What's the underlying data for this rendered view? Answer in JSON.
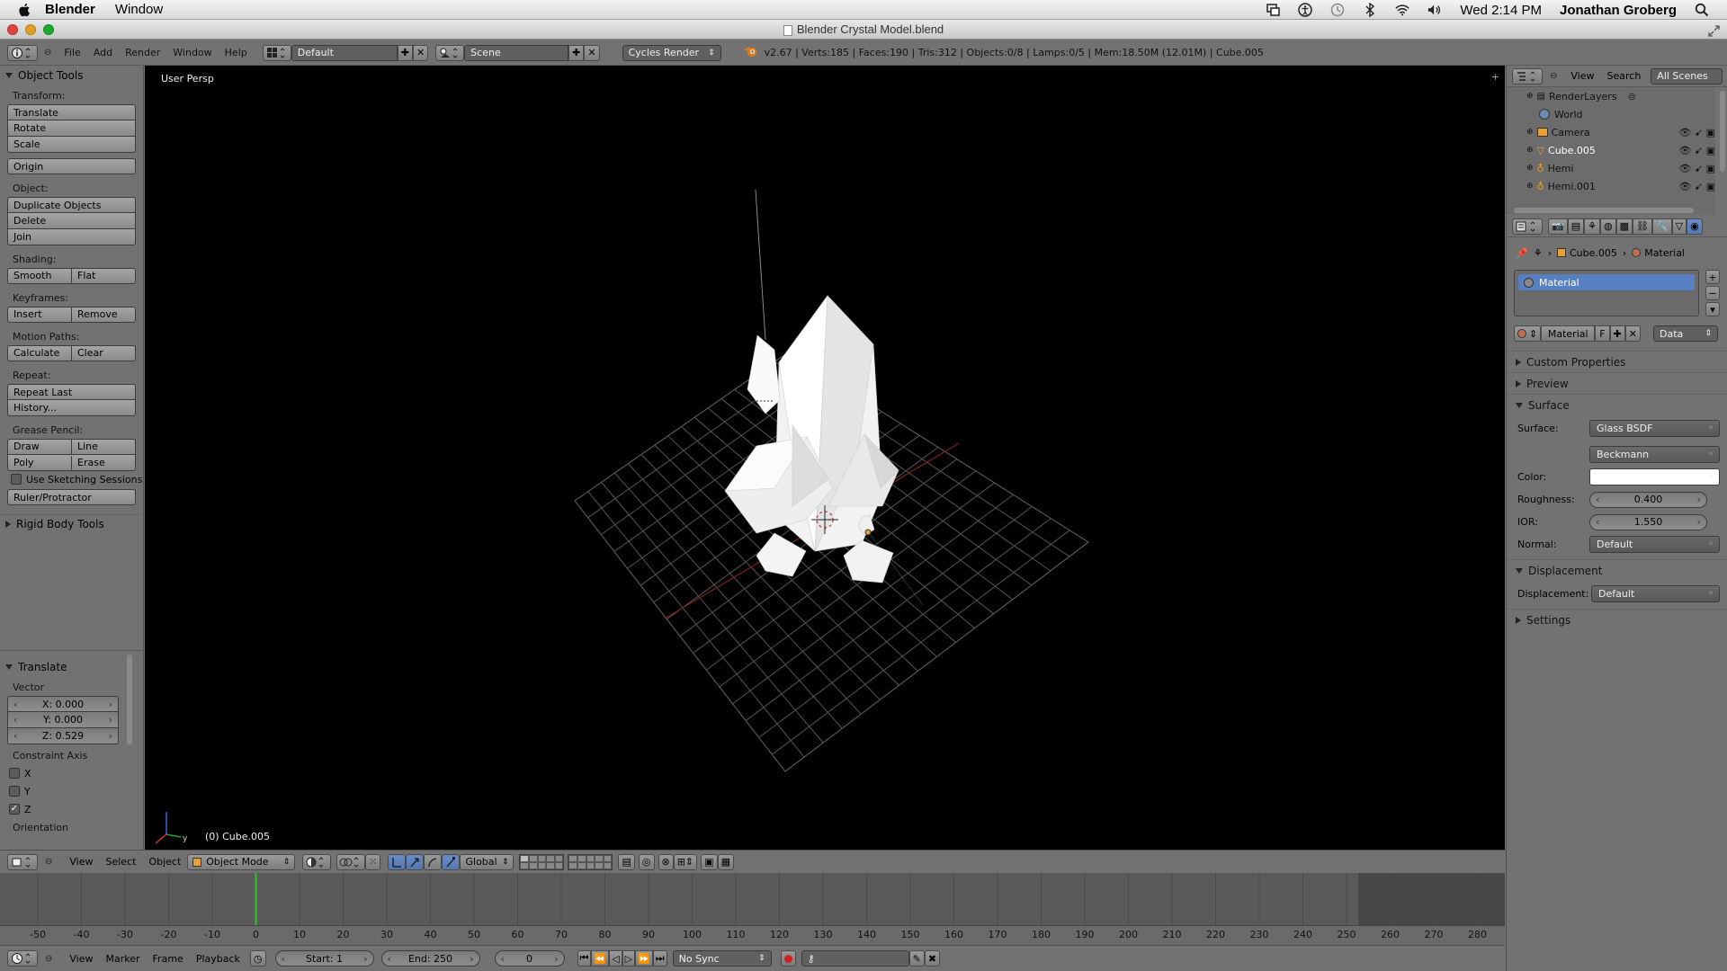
{
  "menubar": {
    "app": "Blender",
    "menu": "Window",
    "clock": "Wed 2:14 PM",
    "user": "Jonathan Groberg"
  },
  "window": {
    "title": "Blender Crystal Model.blend"
  },
  "info_header": {
    "menus": [
      "File",
      "Add",
      "Render",
      "Window",
      "Help"
    ],
    "screen_layout": "Default",
    "scene": "Scene",
    "render_engine": "Cycles Render",
    "stats": "v2.67 | Verts:185 | Faces:190 | Tris:312 | Objects:0/8 | Lamps:0/5 | Mem:18.50M (12.01M) | Cube.005"
  },
  "toolshelf": {
    "title": "Object Tools",
    "transform_label": "Transform:",
    "translate": "Translate",
    "rotate": "Rotate",
    "scale": "Scale",
    "origin": "Origin",
    "object_label": "Object:",
    "duplicate": "Duplicate Objects",
    "delete": "Delete",
    "join": "Join",
    "shading_label": "Shading:",
    "smooth": "Smooth",
    "flat": "Flat",
    "keyframes_label": "Keyframes:",
    "insert": "Insert",
    "remove": "Remove",
    "motion_label": "Motion Paths:",
    "calculate": "Calculate",
    "clear": "Clear",
    "repeat_label": "Repeat:",
    "repeat_last": "Repeat Last",
    "history": "History...",
    "grease_label": "Grease Pencil:",
    "draw": "Draw",
    "line": "Line",
    "poly": "Poly",
    "erase": "Erase",
    "sketching": "Use Sketching Sessions",
    "ruler": "Ruler/Protractor",
    "rigid": "Rigid Body Tools"
  },
  "operator": {
    "title": "Translate",
    "vector_label": "Vector",
    "x": "X: 0.000",
    "y": "Y: 0.000",
    "z": "Z: 0.529",
    "constraint_label": "Constraint Axis",
    "cx": "X",
    "cy": "Y",
    "cz": "Z",
    "orientation_label": "Orientation"
  },
  "viewport": {
    "view_label": "User Persp",
    "object_label": "(0) Cube.005"
  },
  "view3d_header": {
    "menus": [
      "View",
      "Select",
      "Object"
    ],
    "mode": "Object Mode",
    "orientation": "Global"
  },
  "timeline": {
    "ticks": [
      "-50",
      "-40",
      "-30",
      "-20",
      "-10",
      "0",
      "10",
      "20",
      "30",
      "40",
      "50",
      "60",
      "70",
      "80",
      "90",
      "100",
      "110",
      "120",
      "130",
      "140",
      "150",
      "160",
      "170",
      "180",
      "190",
      "200",
      "210",
      "220",
      "230",
      "240",
      "250",
      "260",
      "270",
      "280"
    ],
    "current_frame": 0,
    "menus": [
      "View",
      "Marker",
      "Frame",
      "Playback"
    ],
    "start": "Start: 1",
    "end": "End: 250",
    "frame": "0",
    "sync": "No Sync"
  },
  "outliner": {
    "menus": [
      "View",
      "Search"
    ],
    "filter": "All Scenes",
    "items": [
      {
        "label": "RenderLayers"
      },
      {
        "label": "World"
      },
      {
        "label": "Camera"
      },
      {
        "label": "Cube.005"
      },
      {
        "label": "Hemi"
      },
      {
        "label": "Hemi.001"
      }
    ]
  },
  "properties": {
    "breadcrumb_object": "Cube.005",
    "breadcrumb_material": "Material",
    "slot": "Material",
    "material_name": "Material",
    "material_f": "F",
    "link": "Data",
    "sections": {
      "custom": "Custom Properties",
      "preview": "Preview",
      "surface": "Surface",
      "displacement": "Displacement",
      "settings": "Settings"
    },
    "surface_label": "Surface:",
    "surface_value": "Glass BSDF",
    "distribution": "Beckmann",
    "color_label": "Color:",
    "roughness_label": "Roughness:",
    "roughness_value": "0.400",
    "ior_label": "IOR:",
    "ior_value": "1.550",
    "normal_label": "Normal:",
    "normal_value": "Default",
    "displacement_label": "Displacement:",
    "displacement_value": "Default"
  }
}
